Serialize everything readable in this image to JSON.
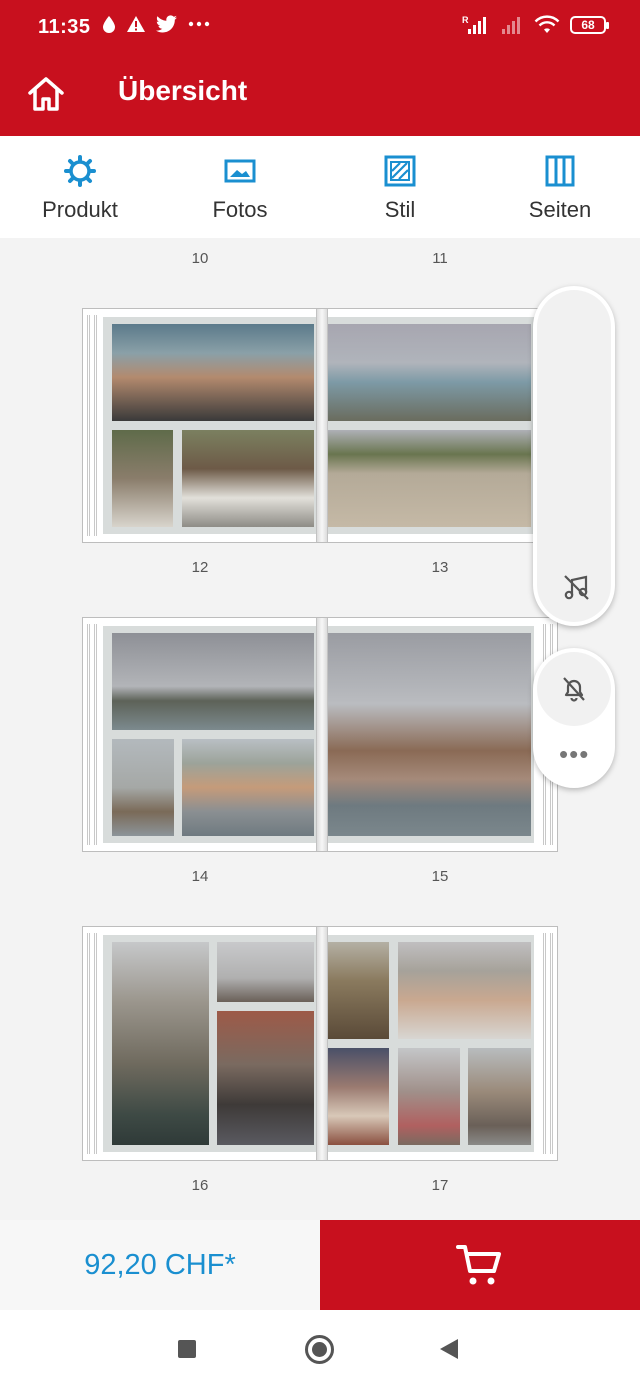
{
  "status_bar": {
    "time": "11:35",
    "battery": "68",
    "left_icons": [
      "water-drop-icon",
      "warning-icon",
      "twitter-icon",
      "more-dots-icon"
    ],
    "right_icons": [
      "signal-r-icon",
      "signal-weak-icon",
      "wifi-icon",
      "battery-icon"
    ]
  },
  "app_bar": {
    "title": "Übersicht",
    "home_icon": "home-icon"
  },
  "tabs": [
    {
      "label": "Produkt",
      "icon": "gear-icon"
    },
    {
      "label": "Fotos",
      "icon": "image-icon"
    },
    {
      "label": "Stil",
      "icon": "style-icon"
    },
    {
      "label": "Seiten",
      "icon": "pages-icon"
    }
  ],
  "spreads": [
    {
      "left_page": "10",
      "right_page": "11",
      "under_left": "12",
      "under_right": "13"
    },
    {
      "left_page": "12",
      "right_page": "13",
      "under_left": "14",
      "under_right": "15"
    },
    {
      "left_page": "14",
      "right_page": "15",
      "under_left": "16",
      "under_right": "17"
    }
  ],
  "page_labels": [
    "10",
    "11",
    "12",
    "13",
    "14",
    "15",
    "16",
    "17"
  ],
  "floating_actions": {
    "music_icon": "music-off-icon",
    "bell_icon": "bell-off-icon",
    "more_icon": "more-dots-icon",
    "more_label": "•••"
  },
  "bottom": {
    "price": "92,20 CHF*",
    "cart_icon": "cart-icon"
  },
  "colors": {
    "brand_red": "#c8101e",
    "accent_blue": "#1a8fd0"
  }
}
